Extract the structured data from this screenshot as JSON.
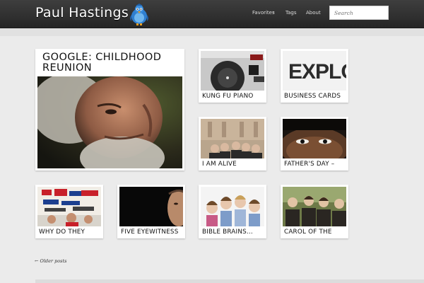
{
  "header": {
    "site_title": "Paul Hastings",
    "nav": {
      "favorites": "Favorites",
      "caret": "▾",
      "tags": "Tags",
      "about": "About"
    },
    "search_placeholder": "Search"
  },
  "posts": {
    "featured": {
      "title": "GOOGLE: CHILDHOOD REUNION"
    },
    "items": [
      {
        "title": "KUNG FU PIANO"
      },
      {
        "title": "BUSINESS CARDS",
        "thumb_text": "EXPLO"
      },
      {
        "title": "I AM ALIVE"
      },
      {
        "title": "FATHER'S DAY –"
      },
      {
        "title": "WHY DO THEY"
      },
      {
        "title": "FIVE EYEWITNESS"
      },
      {
        "title": "BIBLE BRAINS..."
      },
      {
        "title": "CAROL OF THE"
      }
    ]
  },
  "pagination": {
    "older": "← Older posts"
  }
}
